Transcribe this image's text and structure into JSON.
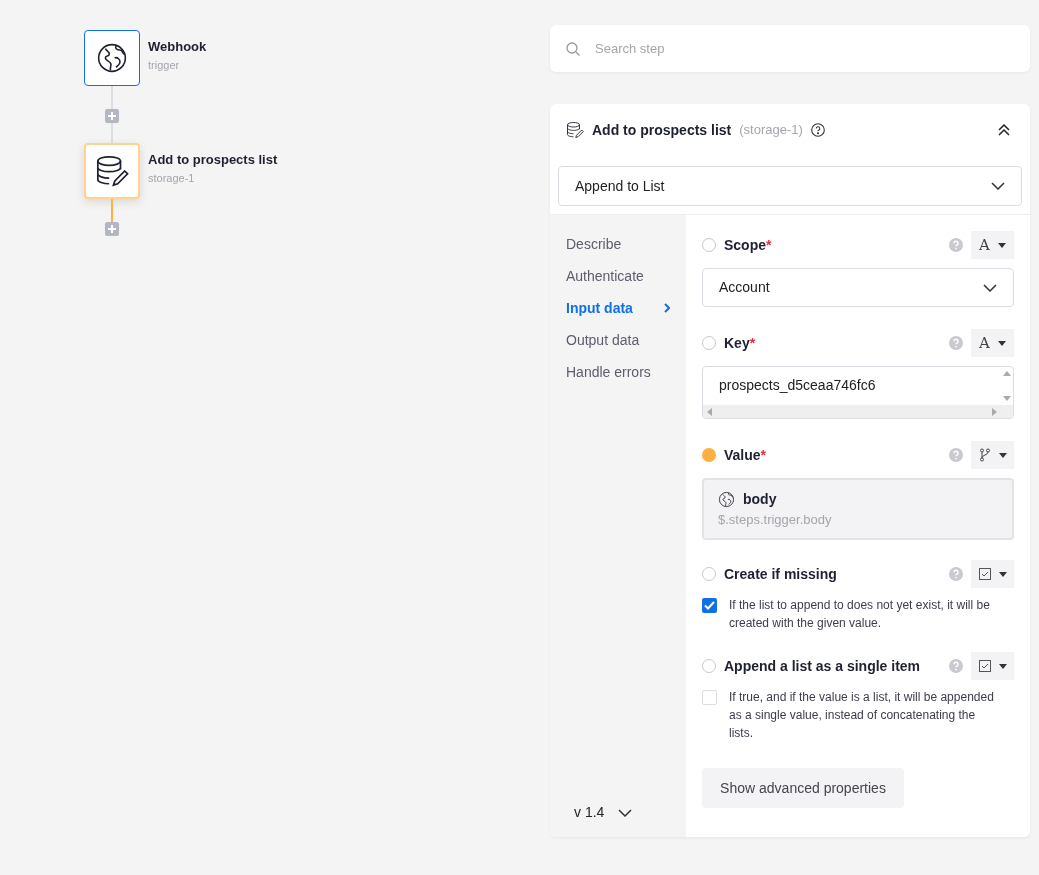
{
  "canvas": {
    "nodes": [
      {
        "kind": "trigger",
        "title": "Webhook",
        "subtitle": "trigger",
        "selected": false
      },
      {
        "kind": "storage",
        "title": "Add to prospects list",
        "subtitle": "storage-1",
        "selected": true
      }
    ]
  },
  "search": {
    "placeholder": "Search step"
  },
  "step_panel": {
    "title": "Add to prospects list",
    "id": "(storage-1)",
    "expanded": true,
    "action": "Append to List",
    "nav": [
      {
        "label": "Describe",
        "selected": false
      },
      {
        "label": "Authenticate",
        "selected": false
      },
      {
        "label": "Input data",
        "selected": true
      },
      {
        "label": "Output data",
        "selected": false
      },
      {
        "label": "Handle errors",
        "selected": false
      }
    ],
    "version": "v 1.4",
    "fields": [
      {
        "kind": "select",
        "label": "Scope",
        "required_mark": "*",
        "set": false,
        "type": {
          "kind": "text",
          "label": "A"
        },
        "value": "Account"
      },
      {
        "kind": "textarea",
        "label": "Key",
        "required_mark": "*",
        "set": false,
        "type": {
          "kind": "text",
          "label": "A"
        },
        "value": "prospects_d5ceaa746fc6"
      },
      {
        "kind": "reference",
        "label": "Value",
        "required_mark": "*",
        "set": true,
        "type": {
          "kind": "branch"
        },
        "name": "body",
        "path": "$.steps.trigger.body"
      },
      {
        "kind": "checkbox",
        "label": "Create if missing",
        "set": false,
        "type": {
          "kind": "checkbox"
        },
        "checked": true,
        "description": "If the list to append to does not yet exist, it will be created with the given value."
      },
      {
        "kind": "checkbox",
        "label": "Append a list as a single item",
        "set": false,
        "type": {
          "kind": "checkbox"
        },
        "checked": false,
        "description": "If true, and if the value is a list, it will be appended as a single value, instead of concatenating the lists."
      }
    ],
    "advanced_button": "Show advanced properties"
  }
}
